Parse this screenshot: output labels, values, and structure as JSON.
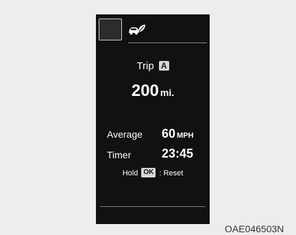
{
  "cluster": {
    "eco_icon": "eco-car-leaf-icon",
    "trip": {
      "label": "Trip",
      "key": "A"
    },
    "distance": {
      "value": "200",
      "unit": "mi."
    },
    "average": {
      "label": "Average",
      "value": "60",
      "unit": "MPH"
    },
    "timer": {
      "label": "Timer",
      "value": "23:45"
    },
    "hint": {
      "prefix": "Hold",
      "key": "OK",
      "suffix": ": Reset"
    }
  },
  "caption": "OAE046503N",
  "colors": {
    "panel": "#111111",
    "background": "#ededed",
    "key_bg": "#d6d6d6"
  }
}
